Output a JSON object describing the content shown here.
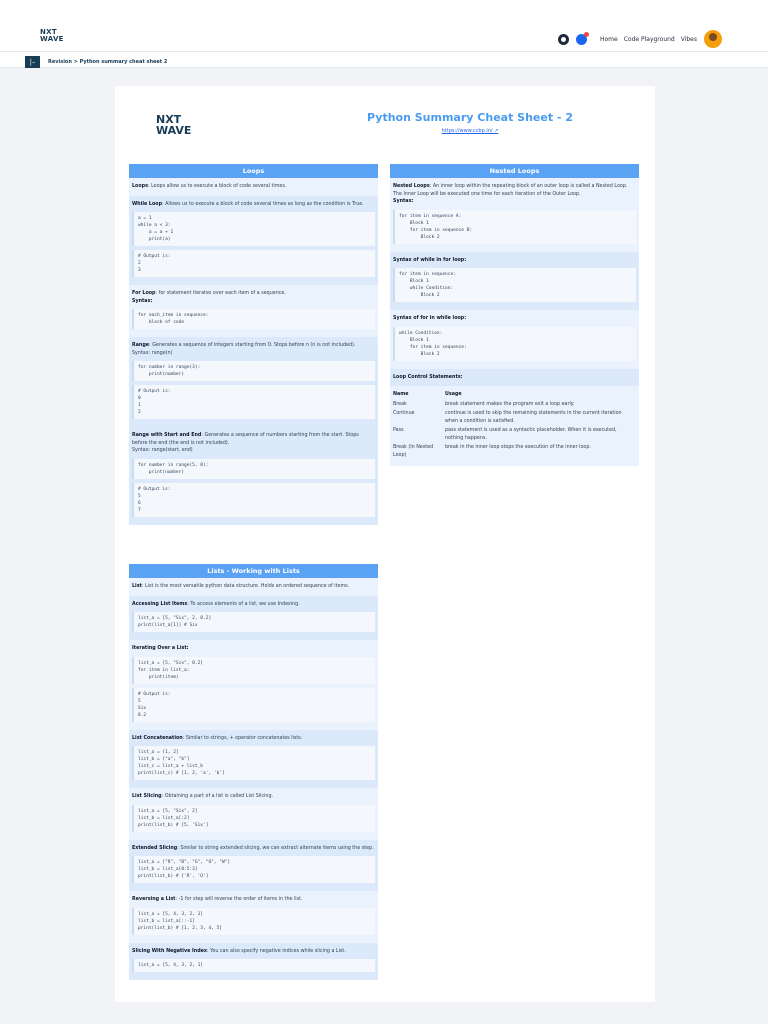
{
  "topbar": {
    "logo_line1": "NXT",
    "logo_line2": "WAVE",
    "nav": [
      "Home",
      "Code Playground",
      "Vibes"
    ]
  },
  "breadcrumb": "Revision > Python summary cheat sheet 2",
  "sheet": {
    "logo_line1": "NXT",
    "logo_line2": "WAVE",
    "title": "Python Summary Cheat Sheet - 2",
    "link": "https://www.ccbp.in/ ↗"
  },
  "loops": {
    "header": "Loops",
    "intro_b": "Loops",
    "intro": ": Loops allow us to execute a block of code several times.",
    "while_b": "While Loop",
    "while": ": Allows us to execute a block of code several times as long as the condition is True.",
    "while_code": "a = 1\nwhile a < 3:\n    a = a + 1\n    print(a)",
    "while_out": "# Output is:\n2\n3",
    "for_b": "For Loop",
    "for": ": for statement iterates over each item of a sequence.",
    "syntax": "Syntax:",
    "for_code": "for each_item in sequence:\n    block of code",
    "range_b": "Range",
    "range": ": Generates a sequence of integers starting from 0. Stops before n (n is not included).",
    "range_syn": "Syntax: range(n)",
    "range_code": "for number in range(3):\n    print(number)",
    "range_out": "# Output is:\n0\n1\n2",
    "rse_b": "Range with Start and End",
    "rse": ": Generates a sequence of numbers starting from the start. Stops before the end (the end is not included).",
    "rse_syn": "Syntax: range(start, end)",
    "rse_code": "for number in range(5, 8):\n    print(number)",
    "rse_out": "# Output is:\n5\n6\n7"
  },
  "nested": {
    "header": "Nested Loops",
    "intro_b": "Nested Loops",
    "intro": ": An inner loop within the repeating block of an outer loop is called a Nested Loop. The Inner Loop will be executed one time for each iteration of the Outer Loop.",
    "syntax": "Syntax:",
    "code1": "for item in sequence A:\n    Block 1\n    for item in sequence B:\n        Block 2",
    "wf_title": "Syntax of while in for loop:",
    "code2": "for item in sequence:\n    Block 1\n    while Condition:\n        Block 2",
    "fw_title": "Syntax of for in while loop:",
    "code3": "while Condition:\n    Block 1\n    for item in sequence:\n        Block 2",
    "lcs_title": "Loop Control Statements:",
    "th_name": "Name",
    "th_usage": "Usage",
    "rows": [
      {
        "name": "Break",
        "usage": "break statement makes the program exit a loop early."
      },
      {
        "name": "Continue",
        "usage": "continue is used to skip the remaining statements in the current iteration when a condition is satisfied."
      },
      {
        "name": "Pass",
        "usage": "pass statement is used as a syntactic placeholder. When it is executed, nothing happens."
      },
      {
        "name": "Break (In Nested Loop)",
        "usage": "break in the inner loop stops the execution of the inner loop."
      }
    ]
  },
  "lists": {
    "header": "Lists - Working with Lists",
    "intro_b": "List",
    "intro": ": List is the most versatile python data structure. Holds an ordered sequence of items.",
    "acc_b": "Accessing List Items",
    "acc": ": To access elements of a list, we use Indexing.",
    "acc_code": "list_a = [5, \"Six\", 2, 8.2]\nprint(list_a[1]) # Six",
    "it_b": "Iterating Over a List:",
    "it_code": "list_a = [5, \"Six\", 8.2]\nfor item in list_a:\n    print(item)",
    "it_out": "# Output is:\n5\nSix\n8.2",
    "cat_b": "List Concatenation",
    "cat": ": Similar to strings, + operator concatenates lists.",
    "cat_code": "list_a = [1, 2]\nlist_b = [\"a\", \"b\"]\nlist_c = list_a + list_b\nprint(list_c) # [1, 2, 'a', 'b']",
    "sl_b": "List Slicing",
    "sl": ": Obtaining a part of a list is called List Slicing.",
    "sl_code": "list_a = [5, \"Six\", 2]\nlist_b = list_a[:2]\nprint(list_b) # [5, 'Six']",
    "ex_b": "Extended Slicing",
    "ex": ": Similar to string extended slicing, we can extract alternate items using the step.",
    "ex_code": "list_a = [\"R\", \"B\", \"G\", \"O\", \"W\"]\nlist_b = list_a[0:5:3]\nprint(list_b) # ['R', 'O']",
    "rev_b": "Reversing a List",
    "rev": ": -1 for step will reverse the order of items in the list.",
    "rev_code": "list_a = [5, 4, 3, 2, 1]\nlist_b = list_a[::-1]\nprint(list_b) # [1, 2, 3, 4, 5]",
    "neg_b": "Slicing With Negative Index",
    "neg": ": You can also specify negative indices while slicing a List.",
    "neg_code": "list_a = [5, 4, 3, 2, 1]"
  }
}
